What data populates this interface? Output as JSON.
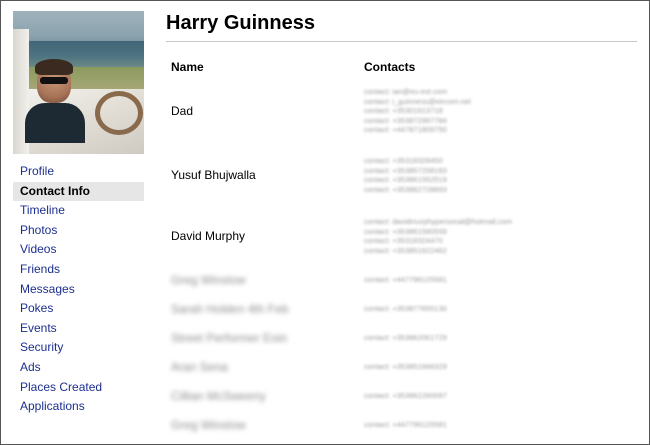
{
  "profile": {
    "name": "Harry Guinness"
  },
  "nav": {
    "items": [
      {
        "label": "Profile",
        "active": false
      },
      {
        "label": "Contact Info",
        "active": true
      },
      {
        "label": "Timeline",
        "active": false
      },
      {
        "label": "Photos",
        "active": false
      },
      {
        "label": "Videos",
        "active": false
      },
      {
        "label": "Friends",
        "active": false
      },
      {
        "label": "Messages",
        "active": false
      },
      {
        "label": "Pokes",
        "active": false
      },
      {
        "label": "Events",
        "active": false
      },
      {
        "label": "Security",
        "active": false
      },
      {
        "label": "Ads",
        "active": false
      },
      {
        "label": "Places Created",
        "active": false
      },
      {
        "label": "Applications",
        "active": false
      }
    ]
  },
  "table": {
    "header_name": "Name",
    "header_contacts": "Contacts",
    "rows": [
      {
        "name": "Dad",
        "name_blurred": false,
        "contacts": [
          "contact: ian@eu-ext.com",
          "contact: i_guinness@eircom.net",
          "contact: +35301613718",
          "contact: +353872997784",
          "contact: +447871809750"
        ]
      },
      {
        "name": "Yusuf Bhujwalla",
        "name_blurred": false,
        "contacts": [
          "contact: +35318328450",
          "contact: +353857258183",
          "contact: +353861552519",
          "contact: +353862728893"
        ]
      },
      {
        "name": "David Murphy",
        "name_blurred": false,
        "contacts": [
          "contact: davidmurphypersonal@hotmail.com",
          "contact: +353861580559",
          "contact: +35318324470",
          "contact: +353851622462"
        ]
      },
      {
        "name": "Greg Winslow",
        "name_blurred": true,
        "contacts": [
          "contact: +447796125581"
        ]
      },
      {
        "name": "Sarah Holden 4th Feb",
        "name_blurred": true,
        "contacts": [
          "contact: +353877655130"
        ]
      },
      {
        "name": "Street Performer Eoin",
        "name_blurred": true,
        "contacts": [
          "contact: +353862061729"
        ]
      },
      {
        "name": "Aran Sena",
        "name_blurred": true,
        "contacts": [
          "contact: +353851666329"
        ]
      },
      {
        "name": "Cillian McSweeny",
        "name_blurred": true,
        "contacts": [
          "contact: +353862260097"
        ]
      },
      {
        "name": "Greg Winslow",
        "name_blurred": true,
        "contacts": [
          "contact: +447796125581"
        ]
      }
    ]
  }
}
